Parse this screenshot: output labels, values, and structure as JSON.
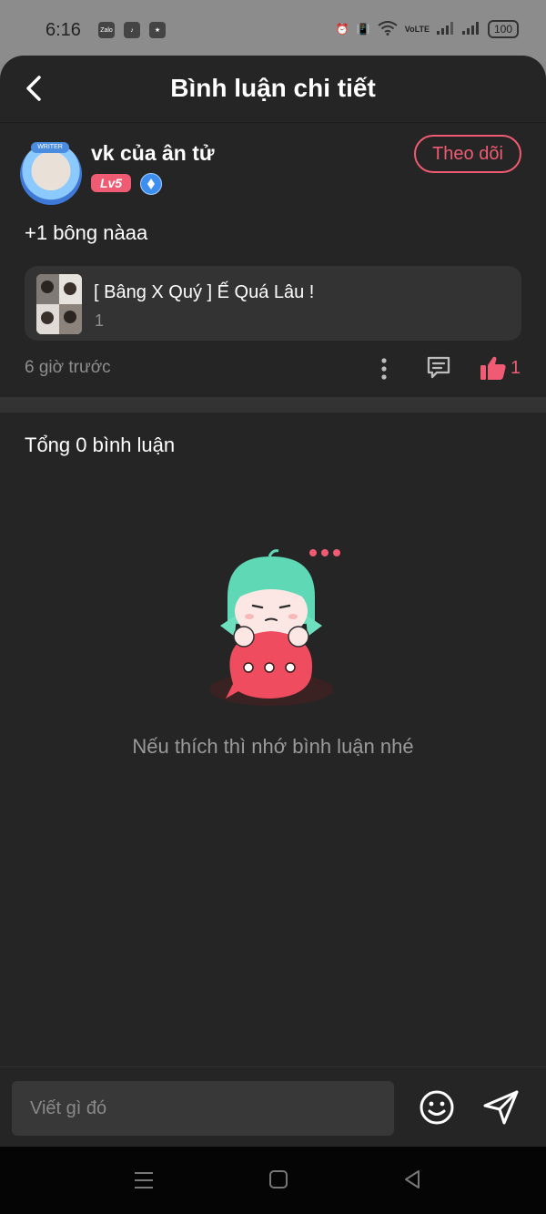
{
  "status_bar": {
    "time": "6:16",
    "apps": [
      "Zalo",
      "TikTok",
      "Tik"
    ],
    "network": "VoLTE",
    "battery": "100"
  },
  "header": {
    "title": "Bình luận chi tiết"
  },
  "comment": {
    "username": "vk của ân tử",
    "level": "Lv5",
    "avatar_tag": "WRITER",
    "follow_label": "Theo dõi",
    "text": "+1 bông nàaa",
    "story": {
      "title": "[ Bâng X Quý ] Ế Quá Lâu !",
      "subtitle": "1"
    },
    "time_ago": "6 giờ trước",
    "like_count": "1"
  },
  "comments_section": {
    "total_label": "Tổng 0 bình luận",
    "empty_message": "Nếu thích thì nhớ bình luận nhé"
  },
  "composer": {
    "placeholder": "Viết gì đó"
  },
  "colors": {
    "accent": "#f05b74",
    "background": "#252525",
    "card": "#333333",
    "muted_text": "#8e8e8e"
  }
}
